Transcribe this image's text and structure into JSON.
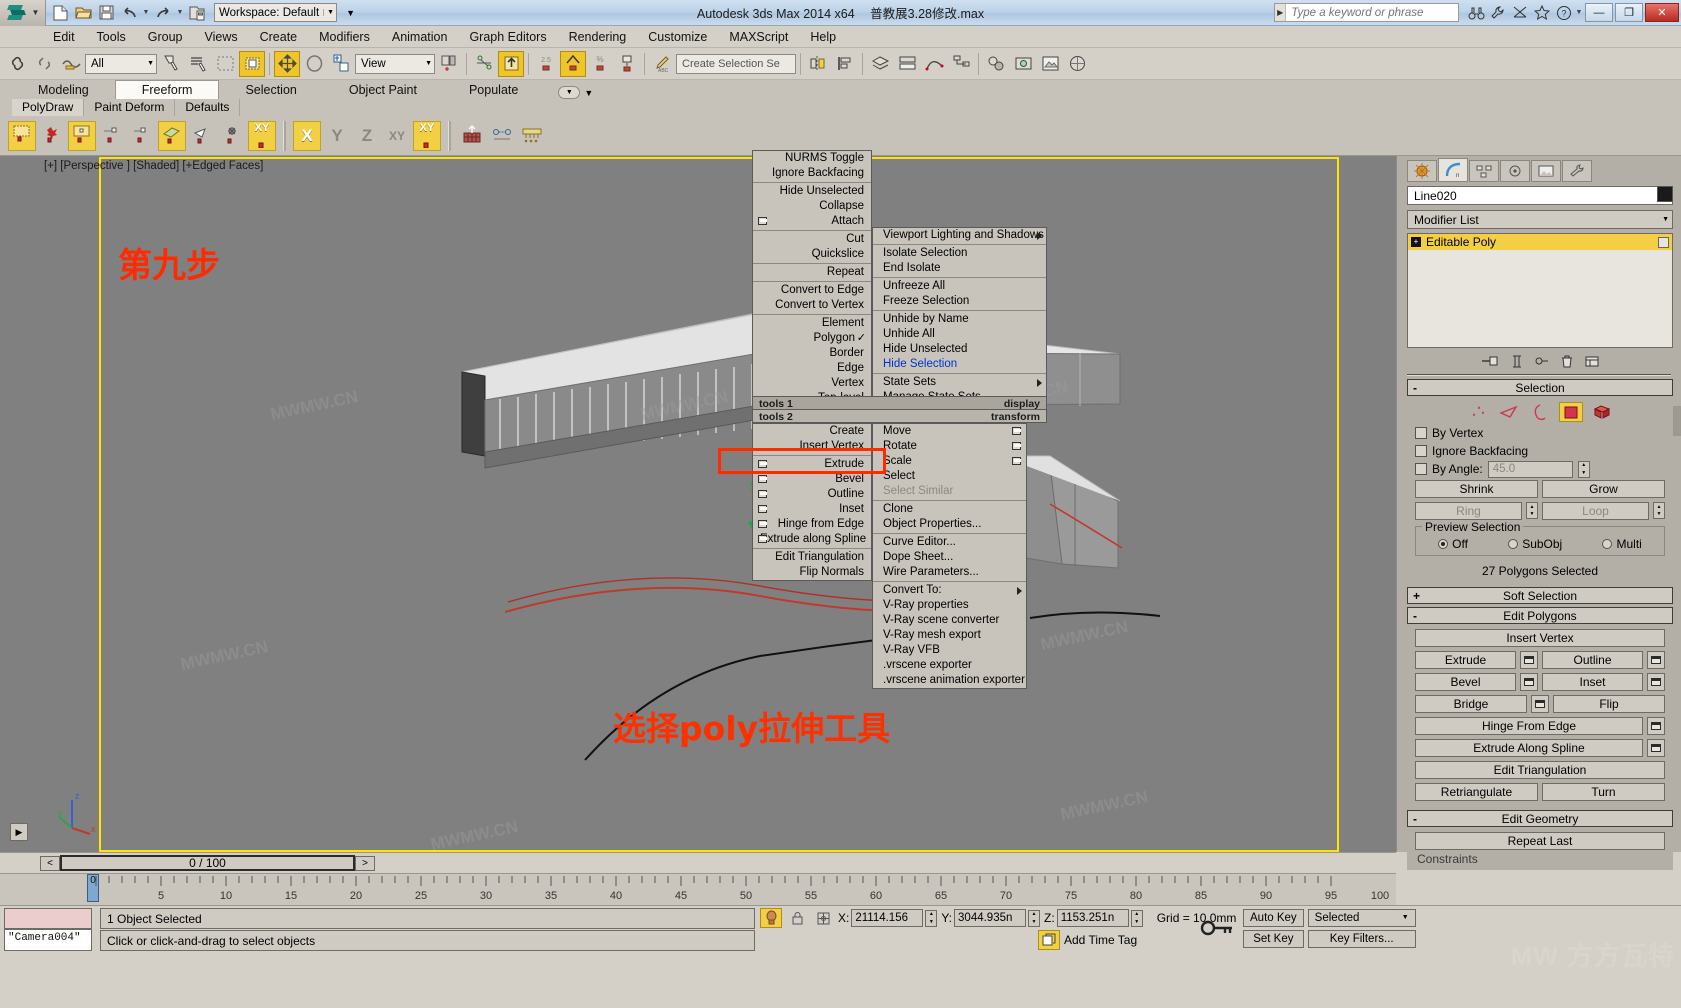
{
  "titlebar": {
    "app_title": "Autodesk 3ds Max  2014 x64",
    "file_name": "普教展3.28修改.max",
    "workspace_label": "Workspace: Default",
    "search_placeholder": "Type a keyword or phrase",
    "icons": [
      "new-icon",
      "open-icon",
      "save-icon",
      "undo-icon",
      "redo-icon",
      "project-icon"
    ],
    "right_icons": [
      "binoculars-icon",
      "wrench-icon",
      "subscription-icon",
      "star-icon",
      "help-icon"
    ],
    "window_buttons": [
      "minimize",
      "restore",
      "close"
    ]
  },
  "menubar": {
    "items": [
      "Edit",
      "Tools",
      "Group",
      "Views",
      "Create",
      "Modifiers",
      "Animation",
      "Graph Editors",
      "Rendering",
      "Customize",
      "MAXScript",
      "Help"
    ]
  },
  "toolbar": {
    "selection_filter": "All",
    "reference_coord": "View",
    "named_selection_placeholder": "Create Selection Se",
    "percent_snap": "2.5"
  },
  "ribbon": {
    "tabs": [
      "Modeling",
      "Freeform",
      "Selection",
      "Object Paint",
      "Populate"
    ],
    "active_tab": "Freeform",
    "subtabs": [
      "PolyDraw",
      "Paint Deform",
      "Defaults"
    ],
    "active_subtab": "PolyDraw",
    "constraint_axes": [
      "X",
      "Y",
      "Z",
      "XY",
      "XY"
    ]
  },
  "viewport": {
    "label": "[+] [Perspective ] [Shaded] [+Edged Faces]",
    "annotation_step": "第九步",
    "annotation_bottom": "选择poly拉伸工具",
    "watermark": "MWMW.CN",
    "axis_labels": [
      "z",
      "y",
      "x"
    ]
  },
  "quad_menu": {
    "upper_left": {
      "groups": [
        [
          "NURMS Toggle",
          "Ignore Backfacing"
        ],
        [
          "Hide Unselected",
          "Collapse",
          "Attach"
        ],
        [
          "Cut",
          "Quickslice"
        ],
        [
          "Repeat"
        ],
        [
          "Convert to Edge",
          "Convert to Vertex"
        ],
        [
          "Element",
          "Polygon",
          "Border",
          "Edge",
          "Vertex",
          "Top-level"
        ]
      ],
      "checked_item": "Polygon",
      "checkbox_items": [
        "Attach"
      ]
    },
    "upper_right": {
      "groups": [
        [
          "Viewport Lighting and Shadows"
        ],
        [
          "Isolate Selection",
          "End Isolate"
        ],
        [
          "Unfreeze All",
          "Freeze Selection"
        ],
        [
          "Unhide by Name",
          "Unhide All",
          "Hide Unselected",
          "Hide Selection"
        ],
        [
          "State Sets",
          "Manage State Sets..."
        ]
      ],
      "submenu_items": [
        "Viewport Lighting and Shadows",
        "State Sets"
      ],
      "highlighted_item": "Hide Selection"
    },
    "headers": {
      "tools1_left": "tools 1",
      "tools1_right": "display",
      "tools2_left": "tools 2",
      "tools2_right": "transform"
    },
    "lower_left": {
      "groups": [
        [
          "Create",
          "Insert Vertex"
        ],
        [
          "Extrude",
          "Bevel",
          "Outline",
          "Inset",
          "Hinge from Edge",
          "Extrude along Spline"
        ],
        [
          "Edit Triangulation",
          "Flip Normals"
        ]
      ],
      "checkbox_items": [
        "Extrude",
        "Bevel",
        "Outline",
        "Inset",
        "Hinge from Edge",
        "Extrude along Spline"
      ],
      "highlighted_item": "Extrude"
    },
    "lower_right": {
      "groups": [
        [
          "Move",
          "Rotate",
          "Scale",
          "Select",
          "Select Similar"
        ],
        [
          "Clone",
          "Object Properties..."
        ],
        [
          "Curve Editor...",
          "Dope Sheet...",
          "Wire Parameters..."
        ],
        [
          "Convert To:",
          "V-Ray properties",
          "V-Ray scene converter",
          "V-Ray mesh export",
          "V-Ray VFB",
          ".vrscene exporter",
          ".vrscene animation exporter"
        ]
      ],
      "disabled_items": [
        "Select Similar"
      ],
      "checkbox_items": [
        "Move",
        "Rotate",
        "Scale"
      ],
      "submenu_items": [
        "Convert To:"
      ]
    }
  },
  "command_panel": {
    "tabs": [
      "create-tab",
      "modify-tab",
      "hierarchy-tab",
      "motion-tab",
      "display-tab",
      "utilities-tab"
    ],
    "active_tab_index": 1,
    "object_name": "Line020",
    "modifier_list_label": "Modifier List",
    "stack_items": [
      "Editable Poly"
    ],
    "rollouts": {
      "selection": {
        "title": "Selection",
        "sign": "-",
        "sub_object_levels": [
          "vertex-icon",
          "edge-icon",
          "border-icon",
          "polygon-icon",
          "element-icon"
        ],
        "active_level_index": 3,
        "by_vertex": "By Vertex",
        "ignore_backfacing": "Ignore Backfacing",
        "by_angle": "By Angle:",
        "by_angle_value": "45.0",
        "shrink": "Shrink",
        "grow": "Grow",
        "ring": "Ring",
        "loop": "Loop",
        "preview_selection_label": "Preview Selection",
        "preview_options": [
          "Off",
          "SubObj",
          "Multi"
        ],
        "preview_selected": "Off",
        "status": "27 Polygons Selected"
      },
      "soft_selection": {
        "title": "Soft Selection",
        "sign": "+"
      },
      "edit_polygons": {
        "title": "Edit Polygons",
        "sign": "-",
        "insert_vertex": "Insert Vertex",
        "extrude": "Extrude",
        "outline": "Outline",
        "bevel": "Bevel",
        "inset": "Inset",
        "bridge": "Bridge",
        "flip": "Flip",
        "hinge_from_edge": "Hinge From Edge",
        "extrude_along_spline": "Extrude Along Spline",
        "edit_triangulation": "Edit Triangulation",
        "retriangulate": "Retriangulate",
        "turn": "Turn"
      },
      "edit_geometry": {
        "title": "Edit Geometry",
        "sign": "-",
        "repeat_last": "Repeat Last"
      },
      "constraints": {
        "title": "Constraints"
      }
    }
  },
  "timeline": {
    "current_frame_label": "0 / 100",
    "prev_label": "<",
    "next_label": ">",
    "ticks": [
      "5",
      "10",
      "15",
      "20",
      "25",
      "30",
      "35",
      "40",
      "45",
      "50",
      "55",
      "60",
      "65",
      "70",
      "75",
      "80",
      "85",
      "90",
      "95",
      "100"
    ],
    "frame_marker": "0"
  },
  "statusbar": {
    "mini_listener_value": "\"Camera004\"",
    "line1": "1 Object Selected",
    "line2": "Click or click-and-drag to select objects",
    "coord_x_label": "X:",
    "coord_x": "21114.156",
    "coord_y_label": "Y:",
    "coord_y": "3044.935n",
    "coord_z_label": "Z:",
    "coord_z": "1153.251n",
    "grid": "Grid = 10.0mm",
    "add_time_tag": "Add Time Tag",
    "auto_key": "Auto Key",
    "set_key": "Set Key",
    "selected_mode": "Selected",
    "key_filters": "Key Filters...",
    "watermark": "MW 方方瓦特"
  },
  "colors": {
    "accent_yellow": "#f2cf43",
    "viewport_border": "#ffe400",
    "annotation_red": "#ff2a00",
    "highlight_blue": "#0033cc",
    "panel_bg": "#b3afa7",
    "chrome_bg": "#d4d0c8"
  }
}
